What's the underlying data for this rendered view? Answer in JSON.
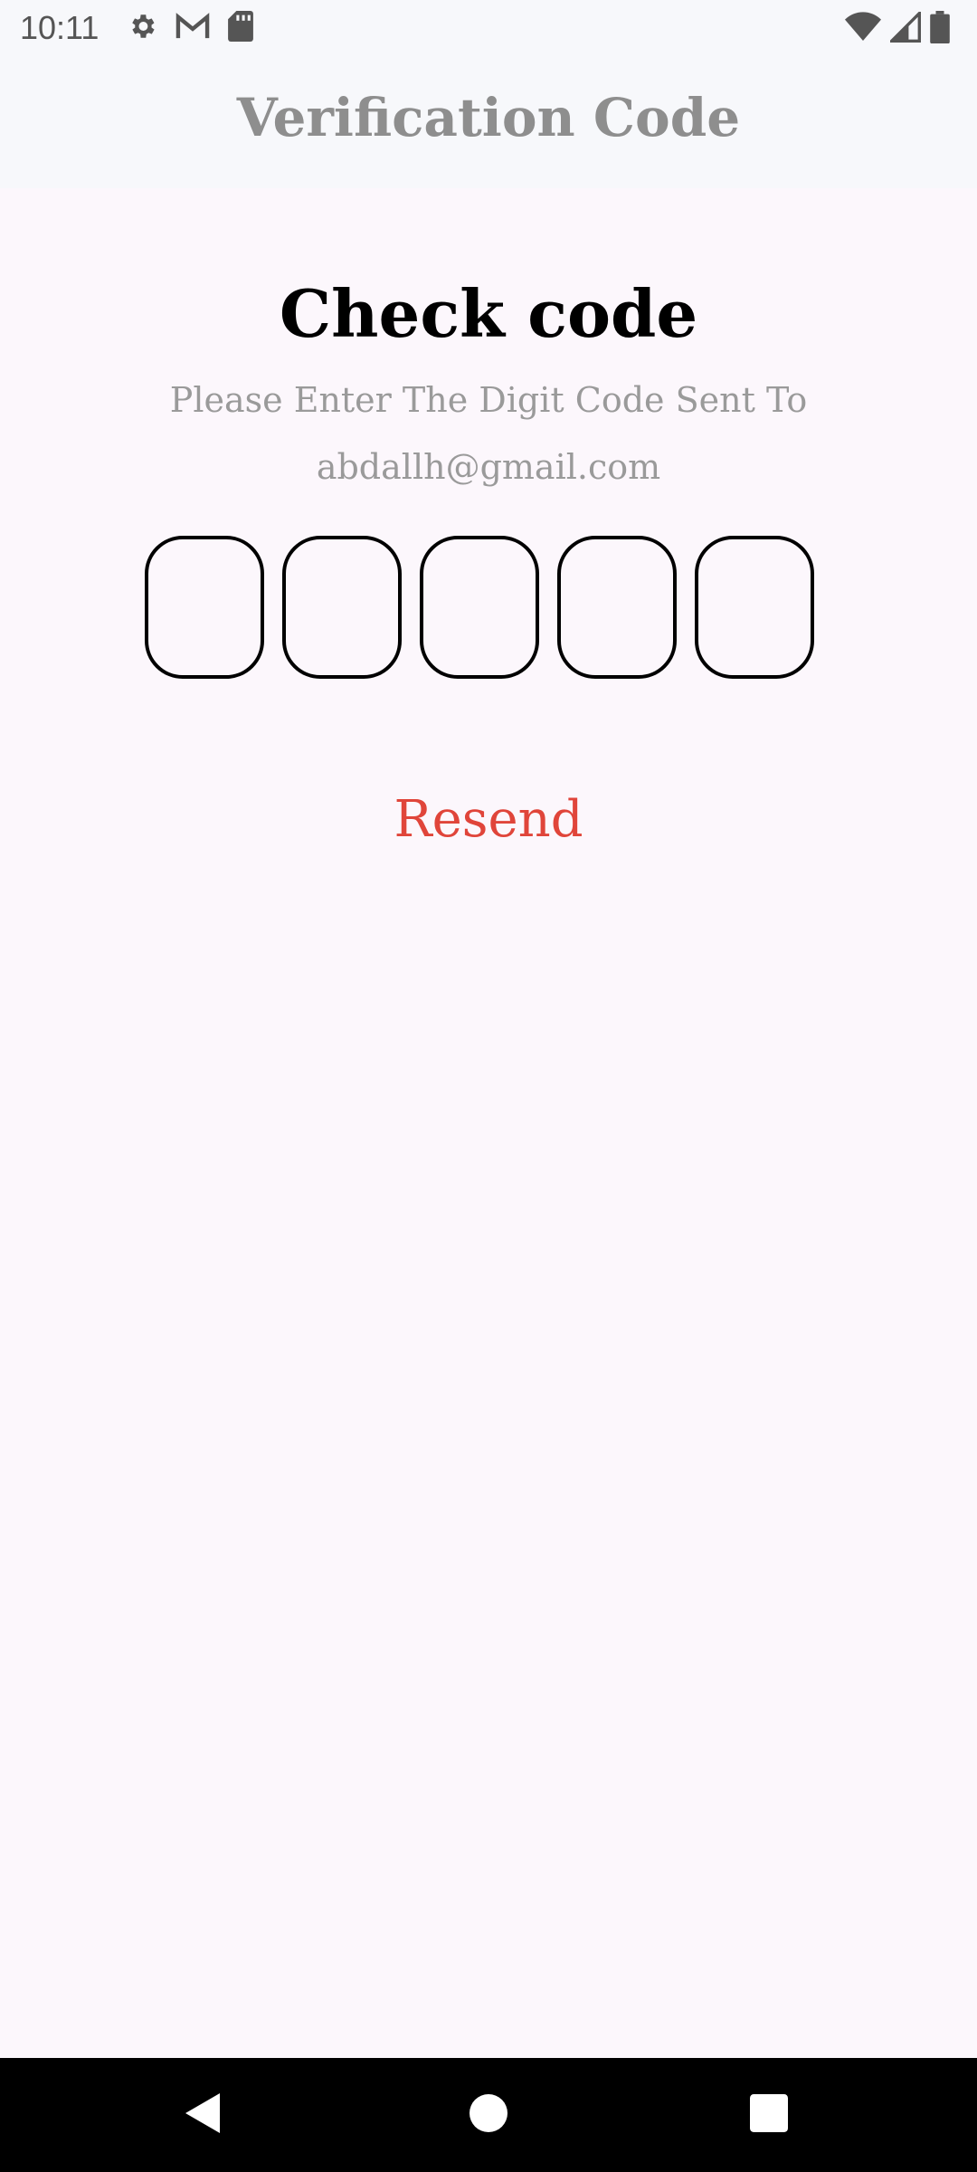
{
  "status_bar": {
    "time": "10:11",
    "left_icons": [
      "gear-icon",
      "gmail-icon",
      "sd-card-icon"
    ],
    "right_icons": [
      "wifi-icon",
      "signal-icon",
      "battery-icon"
    ]
  },
  "app_bar": {
    "title": "Verification Code"
  },
  "main": {
    "heading": "Check code",
    "instruction": "Please Enter The Digit Code Sent To",
    "email": "abdallh@gmail.com",
    "code_inputs": [
      "",
      "",
      "",
      "",
      ""
    ],
    "resend_label": "Resend"
  },
  "colors": {
    "background": "#fcf7fc",
    "app_bar": "#f7f8fb",
    "resend": "#e0453a",
    "muted_text": "#9a9a9a"
  },
  "nav_bar": {
    "buttons": [
      "back-icon",
      "home-icon",
      "recents-icon"
    ]
  }
}
